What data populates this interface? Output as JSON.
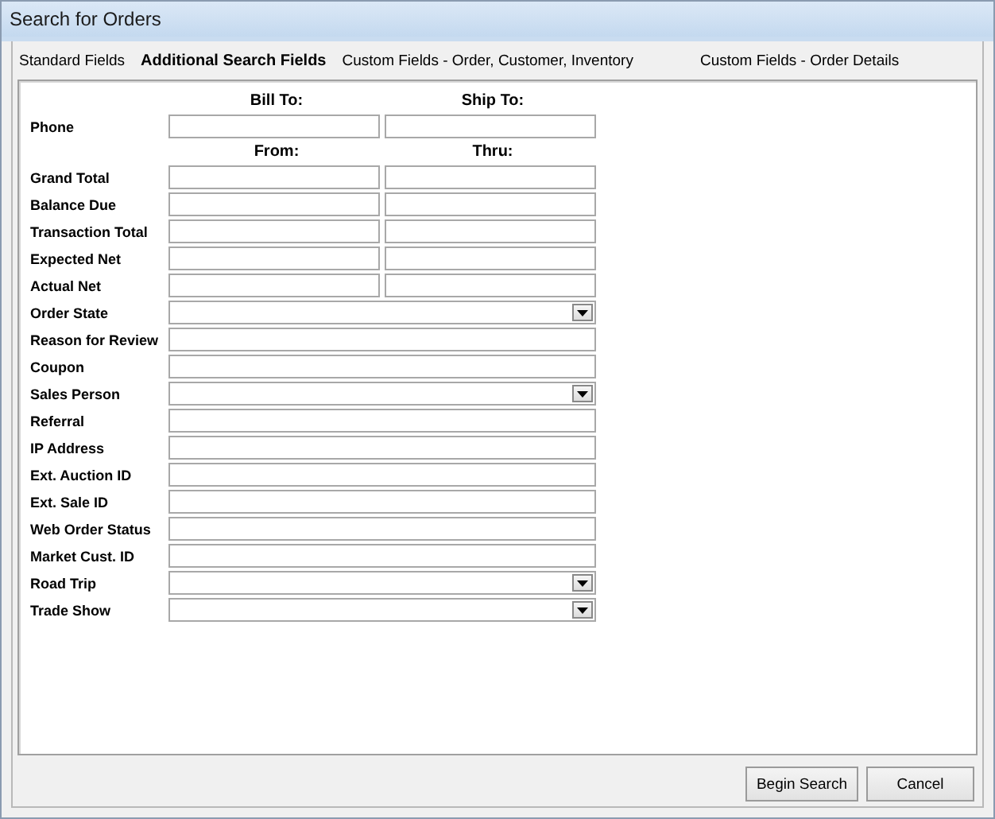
{
  "window": {
    "title": "Search for Orders"
  },
  "tabs": [
    {
      "label": "Standard Fields",
      "selected": false
    },
    {
      "label": "Additional Search Fields",
      "selected": true
    },
    {
      "label": "Custom Fields - Order, Customer, Inventory",
      "selected": false
    },
    {
      "label": "Custom Fields - Order Details",
      "selected": false
    }
  ],
  "rows": [
    {
      "kind": "header",
      "columns": [
        "Bill To:",
        "Ship To:"
      ]
    },
    {
      "kind": "pair",
      "label": "Phone"
    },
    {
      "kind": "header",
      "columns": [
        "From:",
        "Thru:"
      ]
    },
    {
      "kind": "pair",
      "label": "Grand Total"
    },
    {
      "kind": "pair",
      "label": "Balance Due"
    },
    {
      "kind": "pair",
      "label": "Transaction Total"
    },
    {
      "kind": "pair",
      "label": "Expected Net"
    },
    {
      "kind": "pair",
      "label": "Actual Net"
    },
    {
      "kind": "dropdown",
      "label": "Order State"
    },
    {
      "kind": "text",
      "label": "Reason for Review"
    },
    {
      "kind": "text",
      "label": "Coupon"
    },
    {
      "kind": "dropdown",
      "label": "Sales Person"
    },
    {
      "kind": "text",
      "label": "Referral"
    },
    {
      "kind": "text",
      "label": "IP Address"
    },
    {
      "kind": "text",
      "label": "Ext. Auction ID"
    },
    {
      "kind": "text",
      "label": "Ext. Sale ID"
    },
    {
      "kind": "text",
      "label": "Web Order Status"
    },
    {
      "kind": "text",
      "label": "Market Cust. ID"
    },
    {
      "kind": "dropdown",
      "label": "Road Trip"
    },
    {
      "kind": "dropdown",
      "label": "Trade Show"
    }
  ],
  "buttons": [
    "Begin Search",
    "Cancel"
  ]
}
